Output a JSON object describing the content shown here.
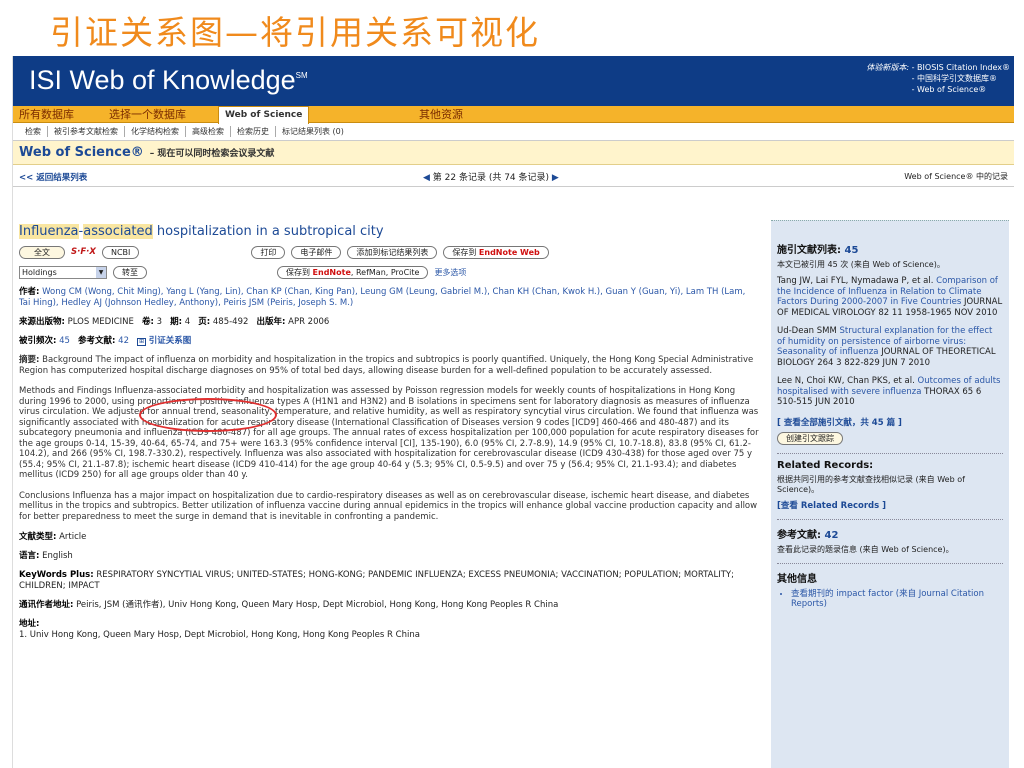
{
  "slide_title": "引证关系图—将引用关系可视化",
  "banner": {
    "logo": "ISI Web of Knowledge",
    "logo_sup": "SM",
    "new_version_label": "体验新版本:",
    "new_version_items": [
      "- BIOSIS Citation Index®",
      "- 中国科学引文数据库®",
      "- Web of Science®"
    ]
  },
  "tabs": [
    "所有数据库",
    "选择一个数据库",
    "Web of Science",
    "其他资源"
  ],
  "subnav": [
    "检索",
    "被引参考文献检索",
    "化学结构检索",
    "高级检索",
    "检索历史",
    "标记结果列表 (0)"
  ],
  "wos_header": {
    "title": "Web of Science®",
    "subtitle": "– 现在可以同时检索会议录文献"
  },
  "record_nav": {
    "back": "<< 返回结果列表",
    "position": "第 22 条记录 (共 74 条记录)",
    "right": "Web of Science® 中的记录"
  },
  "record": {
    "title_pre": "Influenza",
    "title_mid": "-",
    "title_hl2": "associated",
    "title_post": " hospitalization in a subtropical city",
    "buttons": {
      "fulltext": "全文",
      "sfx": "S·F·X",
      "ncbi": "NCBI",
      "print": "打印",
      "email": "电子邮件",
      "add_marked": "添加到标记结果列表",
      "save_to": "保存到",
      "endnote_web": "EndNote Web",
      "save_to2": "保存到",
      "endnote": "EndNote",
      "refman": "RefMan",
      "procite": "ProCite",
      "more": "更多选项",
      "holdings": "Holdings",
      "goto": "转至"
    },
    "authors_label": "作者:",
    "authors_links": "Wong CM",
    "authors_text": "Wong CM (Wong, Chit Ming), Yang L (Yang, Lin), Chan KP (Chan, King Pan), Leung GM (Leung, Gabriel M.), Chan KH (Chan, Kwok H.), Guan Y (Guan, Yi), Lam TH (Lam, Tai Hing), Hedley AJ (Johnson Hedley, Anthony), Peiris JSM (Peiris, Joseph S. M.)",
    "source_label": "来源出版物:",
    "source": "PLOS MEDICINE",
    "volume_label": "卷:",
    "volume": "3",
    "issue_label": "期:",
    "issue": "4",
    "pages_label": "页:",
    "pages": "485-492",
    "pubdate_label": "出版年:",
    "pubdate": "APR 2006",
    "times_cited_label": "被引频次:",
    "times_cited": "45",
    "refs_label": "参考文献:",
    "refs": "42",
    "citation_map": "引证关系图",
    "abstract_label": "摘要:",
    "abstract_p1": "Background The impact of influenza on morbidity and hospitalization in the tropics and subtropics is poorly quantified. Uniquely, the Hong Kong Special Administrative Region has computerized hospital discharge diagnoses on 95% of total bed days, allowing disease burden for a well-defined population to be accurately assessed.",
    "abstract_p2": "Methods and Findings Influenza-associated morbidity and hospitalization was assessed by Poisson regression models for weekly counts of hospitalizations in Hong Kong during 1996 to 2000, using proportions of positive influenza types A (H1N1 and H3N2) and B isolations in specimens sent for laboratory diagnosis as measures of influenza virus circulation. We adjusted for annual trend, seasonality, temperature, and relative humidity, as well as respiratory syncytial virus circulation. We found that influenza was significantly associated with hospitalization for acute respiratory disease (International Classification of Diseases version 9 codes [ICD9] 460-466 and 480-487) and its subcategory pneumonia and influenza (ICD9 480-487) for all age groups. The annual rates of excess hospitalization per 100,000 population for acute respiratory diseases for the age groups 0-14, 15-39, 40-64, 65-74, and 75+ were 163.3 (95% confidence interval [CI], 135-190), 6.0 (95% CI, 2.7-8.9), 14.9 (95% CI, 10.7-18.8), 83.8 (95% CI, 61.2-104.2), and 266 (95% CI, 198.7-330.2), respectively. Influenza was also associated with hospitalization for cerebrovascular disease (ICD9 430-438) for those aged over 75 y (55.4; 95% CI, 21.1-87.8); ischemic heart disease (ICD9 410-414) for the age group 40-64 y (5.3; 95% CI, 0.5-9.5) and over 75 y (56.4; 95% CI, 21.1-93.4); and diabetes mellitus (ICD9 250) for all age groups older than 40 y.",
    "abstract_p3": "Conclusions Influenza has a major impact on hospitalization due to cardio-respiratory diseases as well as on cerebrovascular disease, ischemic heart disease, and diabetes mellitus in the tropics and subtropics. Better utilization of influenza vaccine during annual epidemics in the tropics will enhance global vaccine production capacity and allow for better preparedness to meet the surge in demand that is inevitable in confronting a pandemic.",
    "doctype_label": "文献类型:",
    "doctype": "Article",
    "language_label": "语言:",
    "language": "English",
    "keywords_label": "KeyWords Plus:",
    "keywords": "RESPIRATORY SYNCYTIAL VIRUS; UNITED-STATES; HONG-KONG; PANDEMIC INFLUENZA; EXCESS PNEUMONIA; VACCINATION; POPULATION; MORTALITY; CHILDREN; IMPACT",
    "reprint_label": "通讯作者地址:",
    "reprint": "Peiris, JSM (通讯作者), Univ Hong Kong, Queen Mary Hosp, Dept Microbiol, Hong Kong, Hong Kong Peoples R China",
    "address_label": "地址:",
    "address": "1. Univ Hong Kong, Queen Mary Hosp, Dept Microbiol, Hong Kong, Hong Kong Peoples R China"
  },
  "side": {
    "cited_title": "施引文献列表:",
    "cited_count": "45",
    "cited_sub": "本文已被引用 45 次 (来自 Web of Science)。",
    "citations": [
      {
        "authors": "Tang JW, Lai FYL, Nymadawa P, et al.",
        "title": "Comparison of the Incidence of Influenza in Relation to Climate Factors During 2000-2007 in Five Countries",
        "source": "JOURNAL OF MEDICAL VIROLOGY 82 11 1958-1965 NOV 2010"
      },
      {
        "authors": "Ud-Dean SMM",
        "title": "Structural explanation for the effect of humidity on persistence of airborne virus: Seasonality of influenza",
        "source": "JOURNAL OF THEORETICAL BIOLOGY 264 3 822-829 JUN 7 2010"
      },
      {
        "authors": "Lee N, Choi KW, Chan PKS, et al.",
        "title": "Outcomes of adults hospitalised with severe influenza",
        "source": "THORAX 65 6 510-515 JUN 2010"
      }
    ],
    "view_all": "[ 查看全部施引文献，共 45 篇 ]",
    "create_alert": "创建引文跟踪",
    "related_title": "Related Records:",
    "related_sub": "根据共同引用的参考文献查找相似记录 (来自 Web of Science)。",
    "related_link": "[查看 Related Records ]",
    "refs_title": "参考文献:",
    "refs_count": "42",
    "refs_sub": "查看此记录的题录信息 (来自 Web of Science)。",
    "other_title": "其他信息",
    "other_item": "查看期刊的 impact factor (来自 Journal Citation Reports)"
  }
}
